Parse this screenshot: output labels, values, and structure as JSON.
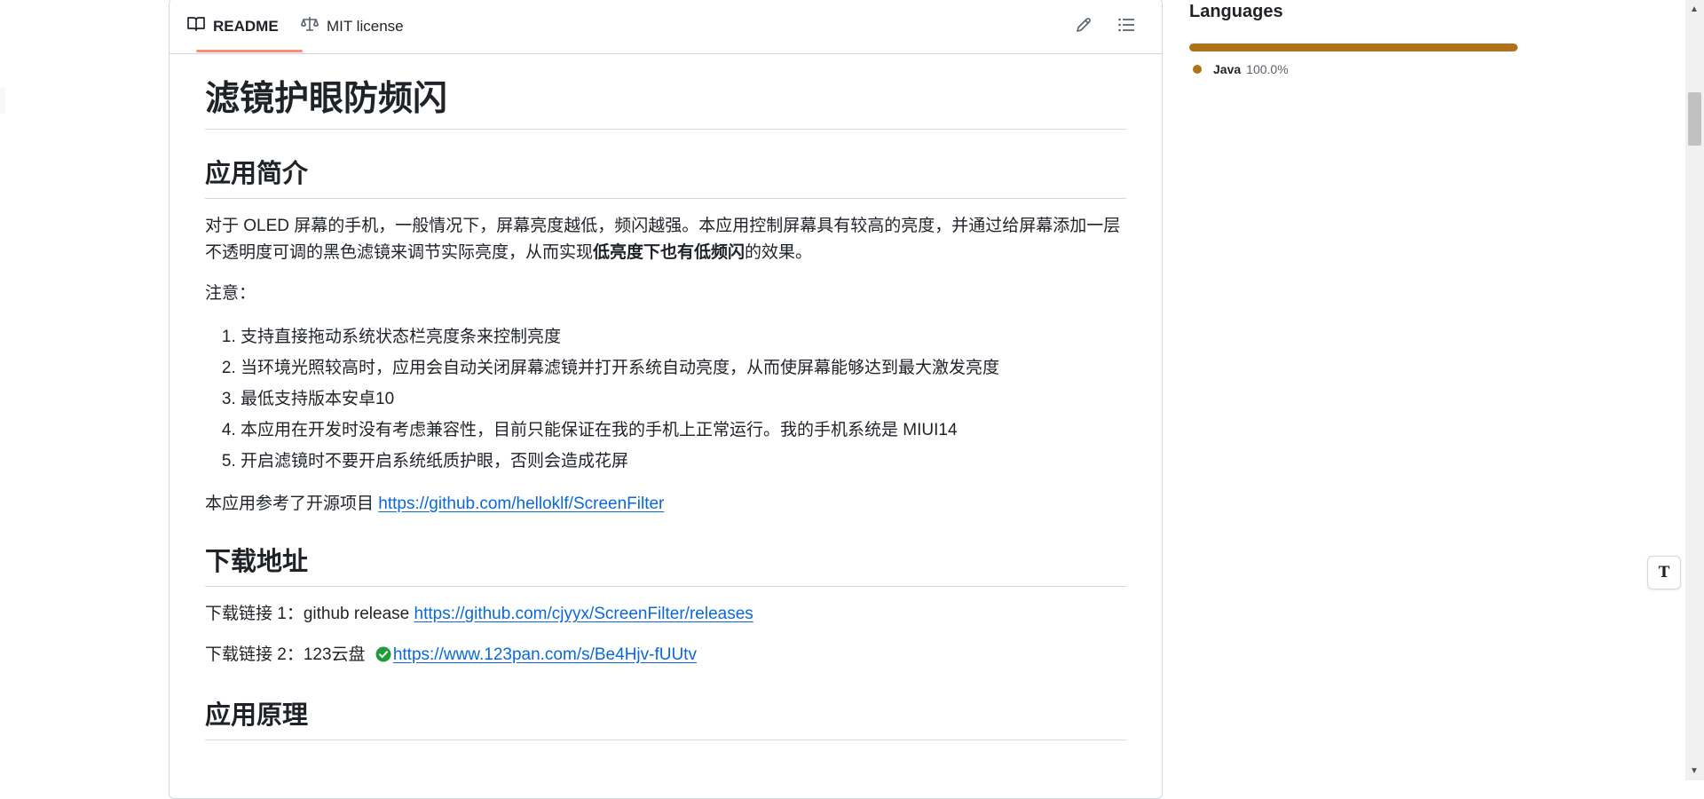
{
  "tabs": {
    "readme": "README",
    "license": "MIT license"
  },
  "readme": {
    "title": "滤镜护眼防频闪",
    "intro_heading": "应用简介",
    "intro_text": "对于 OLED 屏幕的手机，一般情况下，屏幕亮度越低，频闪越强。本应用控制屏幕具有较高的亮度，并通过给屏幕添加一层不透明度可调的黑色滤镜来调节实际亮度，从而实现",
    "intro_bold": "低亮度下也有低频闪",
    "intro_tail": "的效果。",
    "note_label": "注意：",
    "notes": [
      "支持直接拖动系统状态栏亮度条来控制亮度",
      "当环境光照较高时，应用会自动关闭屏幕滤镜并打开系统自动亮度，从而使屏幕能够达到最大激发亮度",
      "最低支持版本安卓10",
      "本应用在开发时没有考虑兼容性，目前只能保证在我的手机上正常运行。我的手机系统是 MIUI14",
      "开启滤镜时不要开启系统纸质护眼，否则会造成花屏"
    ],
    "reference_text": "本应用参考了开源项目 ",
    "reference_link": "https://github.com/helloklf/ScreenFilter",
    "download_heading": "下载地址",
    "download1_text": "下载链接 1：github release ",
    "download1_link": "https://github.com/cjyyx/ScreenFilter/releases",
    "download2_text": "下载链接 2：123云盘 ",
    "download2_link": "https://www.123pan.com/s/Be4Hjv-fUUtv",
    "principle_heading": "应用原理"
  },
  "sidebar": {
    "languages_title": "Languages",
    "language_name": "Java",
    "language_percent": "100.0%",
    "language_color": "#b07219"
  },
  "icons": {
    "readme_tab": "book-icon",
    "license_tab": "scale-icon",
    "edit": "pencil-icon",
    "outline": "list-icon",
    "float": "text-format-icon",
    "check": "check-circle-icon"
  },
  "float_button": {
    "glyph": "T"
  },
  "scrollbar": {
    "up": "▲",
    "down": "▼"
  }
}
